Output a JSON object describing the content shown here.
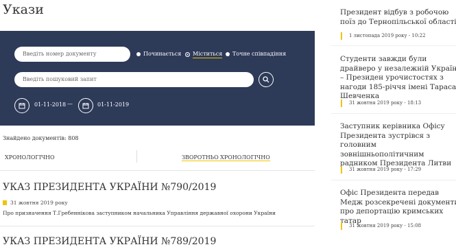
{
  "page": {
    "title": "Укази"
  },
  "search": {
    "doc_number_placeholder": "Введіть номер документу",
    "query_placeholder": "Введіть пошуковий запит",
    "radio": [
      "Починається",
      "Міститься",
      "Точне співпадіння"
    ],
    "radio_selected": "Міститься",
    "date_from": "01-11-2018",
    "date_to": "01-11-2019",
    "date_separator": "—"
  },
  "results": {
    "found": "Знайдено документів: 808"
  },
  "sort": {
    "chronological": "ХРОНОЛОГІЧНО",
    "reverse": "ЗВОРОТНЬО ХРОНОЛОГІЧНО"
  },
  "documents": [
    {
      "title": "УКАЗ ПРЕЗИДЕНТА УКРАЇНИ №790/2019",
      "date": "31 жовтня 2019 року",
      "desc": "Про призначення Т.Гребеннікова заступником начальника Управління державної охорони України"
    },
    {
      "title": "УКАЗ ПРЕЗИДЕНТА УКРАЇНИ №789/2019",
      "date": "",
      "desc": ""
    }
  ],
  "news": [
    {
      "title": "Президент відбув з робочою поїз до Тернопільської області",
      "date": "1 листопада 2019 року - 10:22"
    },
    {
      "title": "Студенти завжди були драйверо у незалежній Україні – Президен урочистостях з нагоди 185-річчя імені Тараса Шевченка",
      "date": "31 жовтня 2019 року - 18:13"
    },
    {
      "title": "Заступник керівника Офісу Президента зустрівся з головним зовнішньополітичним радником Президента Литви",
      "date": "31 жовтня 2019 року - 17:29"
    },
    {
      "title": "Офіс Президента передав Медж розсекречені документи про депортацію кримських татар",
      "date": "31 жовтня 2019 року - 15:08"
    }
  ],
  "colors": {
    "panel": "#2d3a58",
    "accent": "#f0c400"
  },
  "icons": {
    "search": "search-icon",
    "calendar": "calendar-icon"
  }
}
